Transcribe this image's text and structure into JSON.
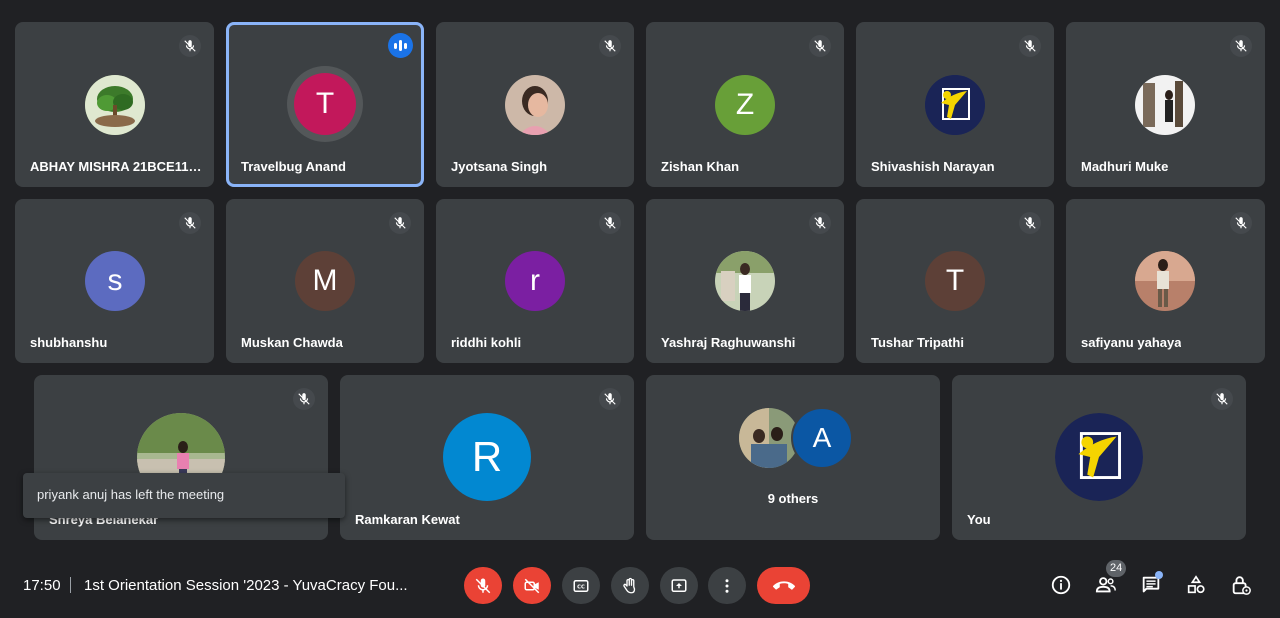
{
  "participants": [
    {
      "name": "ABHAY MISHRA 21BCE110...",
      "muted": true,
      "avatar": "tree-photo"
    },
    {
      "name": "Travelbug Anand",
      "muted": false,
      "speaking": true,
      "initial": "T",
      "color": "#c2185b"
    },
    {
      "name": "Jyotsana Singh",
      "muted": true,
      "avatar": "woman-photo"
    },
    {
      "name": "Zishan Khan",
      "muted": true,
      "initial": "Z",
      "color": "#689f38"
    },
    {
      "name": "Shivashish Narayan",
      "muted": true,
      "avatar": "yuvacracy-logo"
    },
    {
      "name": "Madhuri Muke",
      "muted": true,
      "avatar": "person-photo"
    },
    {
      "name": "shubhanshu",
      "muted": true,
      "initial": "s",
      "color": "#5c6bc0"
    },
    {
      "name": "Muskan Chawda",
      "muted": true,
      "initial": "M",
      "color": "#5d4037"
    },
    {
      "name": "riddhi kohli",
      "muted": true,
      "initial": "r",
      "color": "#7b1fa2"
    },
    {
      "name": "Yashraj Raghuwanshi",
      "muted": true,
      "avatar": "man-photo"
    },
    {
      "name": "Tushar Tripathi",
      "muted": true,
      "initial": "T",
      "color": "#5d4037"
    },
    {
      "name": "safiyanu yahaya",
      "muted": true,
      "avatar": "man-standing-photo"
    },
    {
      "name": "Shreya Belanekar",
      "muted": true,
      "avatar": "outdoor-photo"
    },
    {
      "name": "Ramkaran Kewat",
      "muted": true,
      "initial": "R",
      "color": "#0288d1"
    },
    {
      "name": "9 others",
      "initial": "A",
      "color": "#0b57a4",
      "avatar": "group-photo"
    },
    {
      "name": "You",
      "muted": true,
      "avatar": "yuvacracy-logo"
    }
  ],
  "toast": {
    "message": "priyank anuj has left the meeting"
  },
  "bottom_bar": {
    "time": "17:50",
    "meeting_title": "1st Orientation Session '2023 - YuvaCracy Fou...",
    "participant_count": "24",
    "controls": [
      "mic-off-icon",
      "camera-off-icon",
      "captions-icon",
      "raise-hand-icon",
      "present-icon",
      "more-options-icon",
      "end-call-icon"
    ],
    "right_icons": [
      "info-icon",
      "people-icon",
      "chat-icon",
      "activities-icon",
      "host-controls-icon"
    ]
  },
  "colors": {
    "background": "#202124",
    "tile": "#3c4043",
    "accent": "#8ab4f8",
    "danger": "#ea4335",
    "speaking": "#1a73e8"
  }
}
